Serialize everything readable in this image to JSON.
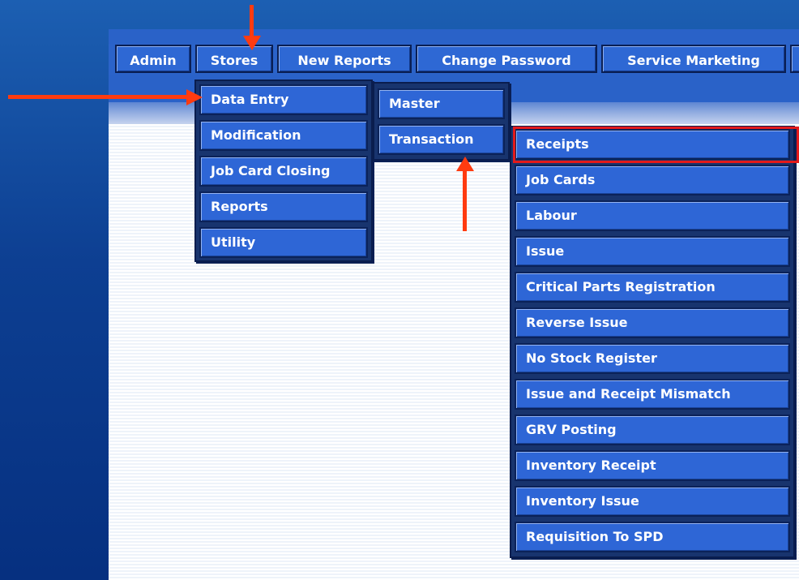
{
  "menu_bar": [
    "Admin",
    "Stores",
    "New Reports",
    "Change Password",
    "Service Marketing"
  ],
  "stores_menu": [
    "Data Entry",
    "Modification",
    "Job Card Closing",
    "Reports",
    "Utility"
  ],
  "data_entry_menu": [
    "Master",
    "Transaction"
  ],
  "transaction_menu": [
    "Receipts",
    "Job Cards",
    "Labour",
    "Issue",
    "Critical Parts Registration",
    "Reverse Issue",
    "No Stock Register",
    "Issue and Receipt Mismatch",
    "GRV Posting",
    "Inventory Receipt",
    "Inventory Issue",
    "Requisition To SPD"
  ],
  "colors": {
    "menu_item_bg": "#2e66d6",
    "highlight_border": "#e31a1a",
    "annotation_arrow": "#ff3b10"
  }
}
